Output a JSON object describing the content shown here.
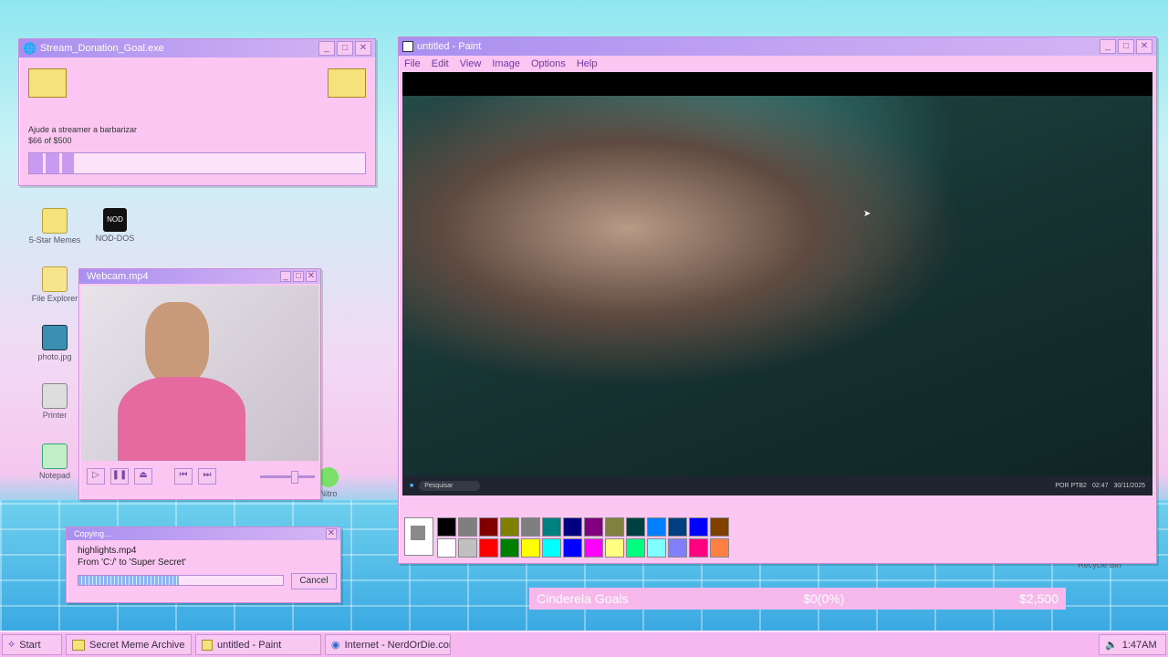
{
  "donation_window": {
    "title": "Stream_Donation_Goal.exe",
    "message": "Ajude a streamer a barbarizar",
    "amount": "$66 of $500",
    "progress": 0.132
  },
  "desktop_icons": [
    {
      "label": "5-Star Memes"
    },
    {
      "label": "NOD-DOS"
    },
    {
      "label": "File Explorer"
    },
    {
      "label": "photo.jpg"
    },
    {
      "label": "Printer"
    },
    {
      "label": "Notepad"
    },
    {
      "label": "Nitro"
    },
    {
      "label": "Recycle Bin"
    }
  ],
  "webcam_window": {
    "title": "Webcam.mp4"
  },
  "copy_dialog": {
    "title": "Copying...",
    "file": "highlights.mp4",
    "from_to": "From 'C:/' to 'Super Secret'",
    "progress": 0.49,
    "cancel_label": "Cancel"
  },
  "paint_window": {
    "title": "untitled - Paint",
    "menu": [
      "File",
      "Edit",
      "View",
      "Image",
      "Options",
      "Help"
    ],
    "inner_taskbar": {
      "search": "Pesquisar",
      "lang": "POR PTB2",
      "time": "02:47",
      "date": "30/11/2025"
    },
    "palette_top": [
      "#000000",
      "#7f7f7f",
      "#800000",
      "#808000",
      "#7f7f7f",
      "#008080",
      "#000080",
      "#800080",
      "#808040",
      "#004040",
      "#0080ff",
      "#004080",
      "#0000ff",
      "#804000"
    ],
    "palette_bottom": [
      "#ffffff",
      "#c0c0c0",
      "#ff0000",
      "#008000",
      "#ffff00",
      "#00ffff",
      "#0000ff",
      "#ff00ff",
      "#ffff80",
      "#00ff80",
      "#80ffff",
      "#8080ff",
      "#ff0080",
      "#ff8040"
    ]
  },
  "goals_bar": {
    "name": "Cinderela Goals",
    "current": "$0(0%)",
    "target": "$2,500"
  },
  "taskbar": {
    "start_label": "Start",
    "items": [
      {
        "label": "Secret Meme Archive"
      },
      {
        "label": "untitled - Paint"
      },
      {
        "label": "Internet - NerdOrDie.com"
      }
    ],
    "clock": "1:47AM"
  }
}
